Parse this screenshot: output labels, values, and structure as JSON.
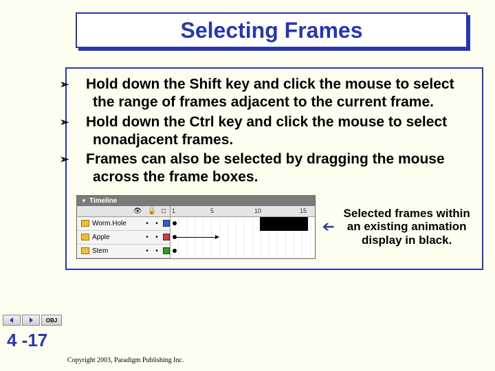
{
  "title": "Selecting Frames",
  "bullets": [
    "Hold down the Shift key and click the mouse to select the range of frames adjacent to the current frame.",
    "Hold down the Ctrl key and click the mouse to select nonadjacent frames.",
    "Frames can also be selected by dragging the mouse across the frame boxes."
  ],
  "timeline": {
    "header": "Timeline",
    "ruler": [
      "1",
      "5",
      "10",
      "15"
    ],
    "icons": {
      "eye": "👁",
      "lock": "🔒",
      "box": "□"
    },
    "layers": [
      {
        "name": "Worm.Hole",
        "color": "#2a5fd8"
      },
      {
        "name": "Apple",
        "color": "#d83a3a"
      },
      {
        "name": "Stem",
        "color": "#1ea81e"
      }
    ]
  },
  "callout": "Selected frames within an existing animation display in black.",
  "nav": {
    "prev": "prev",
    "next": "next",
    "obj": "OBJ"
  },
  "pagenum": "4 -17",
  "copyright": "Copyright 2003, Paradigm Publishing Inc."
}
